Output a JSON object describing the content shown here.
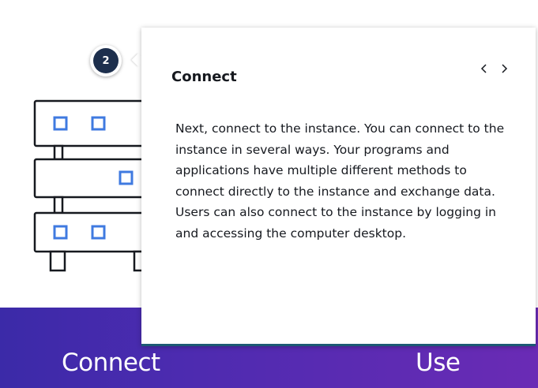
{
  "step": {
    "number": "2"
  },
  "popover": {
    "title": "Connect",
    "body": "Next, connect to the instance. You can connect to the instance in several ways. Your programs and applications have multiple different methods to connect directly to the instance and exchange data. Users can also connect to the instance by logging in and accessing the computer desktop.",
    "prev_icon": "chevron-left-icon",
    "next_icon": "chevron-right-icon"
  },
  "band": {
    "labels": [
      "Connect",
      "Use"
    ]
  },
  "colors": {
    "band_start": "#3b2aa8",
    "band_end": "#6a2bb5",
    "badge": "#1d2f4d",
    "server_square": "#3f7ae0",
    "popover_accent": "#1c5a74"
  }
}
